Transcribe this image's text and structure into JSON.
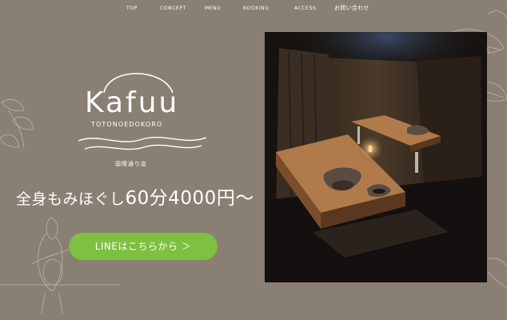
{
  "nav": {
    "items": [
      {
        "label": "TOP"
      },
      {
        "label": "CONCEPT"
      },
      {
        "label": "MENU"
      },
      {
        "label": "BOOKING"
      },
      {
        "label": "ACCESS"
      },
      {
        "label": "お問い合わせ"
      }
    ]
  },
  "logo": {
    "name": "Kafuu",
    "subtitle": "TOTONOEDOKORO",
    "branch": "国際通り店"
  },
  "hero": {
    "tagline_prefix": "全身もみほぐし",
    "tagline_price": "60分4000円〜"
  },
  "cta": {
    "line_label": "LINEはこちらから ＞"
  },
  "colors": {
    "background": "#8a7f73",
    "line_green": "#7ec03f"
  }
}
